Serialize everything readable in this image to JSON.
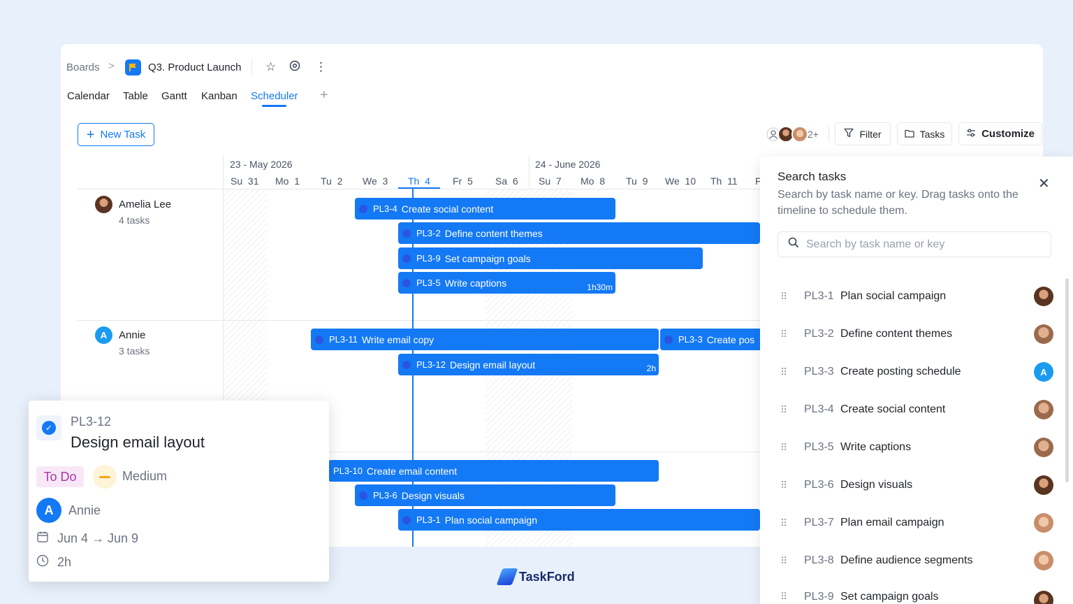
{
  "breadcrumb": {
    "boards": "Boards",
    "separator": ">",
    "board_title": "Q3. Product Launch"
  },
  "tabs": [
    {
      "label": "Calendar"
    },
    {
      "label": "Table"
    },
    {
      "label": "Gantt"
    },
    {
      "label": "Kanban"
    },
    {
      "label": "Scheduler",
      "active": true
    }
  ],
  "toolbar": {
    "new_task": "New Task",
    "more_members": "2+",
    "filter": "Filter",
    "tasks": "Tasks",
    "customize": "Customize"
  },
  "timeline": {
    "weeks": [
      "23 - May 2026",
      "24 - June 2026"
    ],
    "days": [
      {
        "dow": "Su",
        "num": "31"
      },
      {
        "dow": "Mo",
        "num": "1"
      },
      {
        "dow": "Tu",
        "num": "2"
      },
      {
        "dow": "We",
        "num": "3"
      },
      {
        "dow": "Th",
        "num": "4",
        "today": true
      },
      {
        "dow": "Fr",
        "num": "5"
      },
      {
        "dow": "Sa",
        "num": "6"
      },
      {
        "dow": "Su",
        "num": "7"
      },
      {
        "dow": "Mo",
        "num": "8"
      },
      {
        "dow": "Tu",
        "num": "9"
      },
      {
        "dow": "We",
        "num": "10"
      },
      {
        "dow": "Th",
        "num": "11"
      },
      {
        "dow": "F",
        "num": ""
      }
    ]
  },
  "people": [
    {
      "name": "Amelia Lee",
      "tasks": "4 tasks"
    },
    {
      "name": "Annie",
      "initial": "A",
      "tasks": "3 tasks"
    }
  ],
  "bars": [
    {
      "key": "PL3-4",
      "name": "Create social content",
      "duration": ""
    },
    {
      "key": "PL3-2",
      "name": "Define content themes",
      "duration": ""
    },
    {
      "key": "PL3-9",
      "name": "Set campaign goals",
      "duration": ""
    },
    {
      "key": "PL3-5",
      "name": "Write captions",
      "duration": "1h30m"
    },
    {
      "key": "PL3-11",
      "name": "Write email copy",
      "duration": ""
    },
    {
      "key": "PL3-3",
      "name": "Create pos",
      "duration": ""
    },
    {
      "key": "PL3-12",
      "name": "Design email layout",
      "duration": "2h"
    },
    {
      "key": "PL3-10",
      "name": "Create email content",
      "duration": ""
    },
    {
      "key": "PL3-6",
      "name": "Design visuals",
      "duration": ""
    },
    {
      "key": "PL3-1",
      "name": "Plan social campaign",
      "duration": ""
    }
  ],
  "panel": {
    "title": "Search tasks",
    "description": "Search by task name or key. Drag tasks onto the timeline to schedule them.",
    "search_placeholder": "Search by task name or key",
    "tasks": [
      {
        "key": "PL3-1",
        "name": "Plan social campaign",
        "assignee": "photo"
      },
      {
        "key": "PL3-2",
        "name": "Define content themes",
        "assignee": "photo"
      },
      {
        "key": "PL3-3",
        "name": "Create posting schedule",
        "assignee": "A"
      },
      {
        "key": "PL3-4",
        "name": "Create social content",
        "assignee": "photo"
      },
      {
        "key": "PL3-5",
        "name": "Write captions",
        "assignee": "photo"
      },
      {
        "key": "PL3-6",
        "name": "Design visuals",
        "assignee": "photo"
      },
      {
        "key": "PL3-7",
        "name": "Plan email campaign",
        "assignee": "photo"
      },
      {
        "key": "PL3-8",
        "name": "Define audience segments",
        "assignee": "photo"
      },
      {
        "key": "PL3-9",
        "name": "Set campaign goals",
        "assignee": "photo"
      }
    ]
  },
  "popup": {
    "key": "PL3-12",
    "title": "Design email layout",
    "status": "To Do",
    "priority": "Medium",
    "assignee_initial": "A",
    "assignee": "Annie",
    "dates": "Jun 4 → Jun 9",
    "duration": "2h"
  },
  "brand": {
    "name": "TaskFord"
  },
  "colors": {
    "accent": "#1479f5",
    "status_todo_bg": "#f8e7f7",
    "status_todo_text": "#a43aa6",
    "priority_medium": "#f2a519"
  }
}
